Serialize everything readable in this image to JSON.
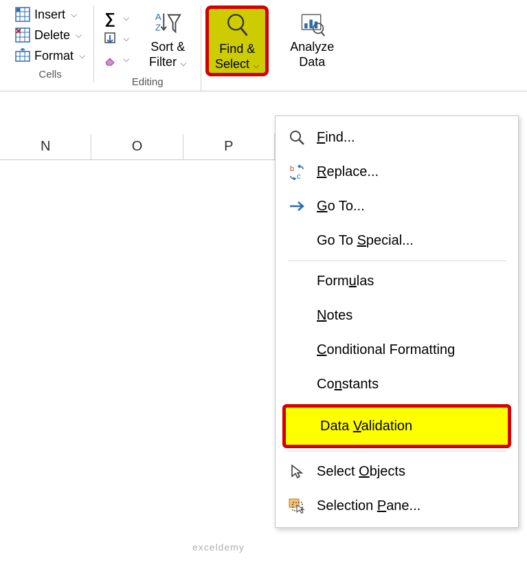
{
  "ribbon": {
    "cells": {
      "insert": "Insert",
      "delete": "Delete",
      "format": "Format",
      "label": "Cells"
    },
    "editing": {
      "sortfilter_line1": "Sort &",
      "sortfilter_line2": "Filter",
      "label": "Editing"
    },
    "findselect": {
      "line1": "Find &",
      "line2": "Select"
    },
    "analyze": {
      "line1": "Analyze",
      "line2": "Data"
    }
  },
  "columns": [
    "N",
    "O",
    "P"
  ],
  "menu": {
    "find": "Find...",
    "replace": "Replace...",
    "goto": "Go To...",
    "gotospecial": "Go To Special...",
    "formulas": "Formulas",
    "notes": "Notes",
    "condformat": "Conditional Formatting",
    "constants": "Constants",
    "datavalidation": "Data Validation",
    "selectobjects": "Select Objects",
    "selectionpane": "Selection Pane..."
  },
  "watermark": "exceldemy"
}
